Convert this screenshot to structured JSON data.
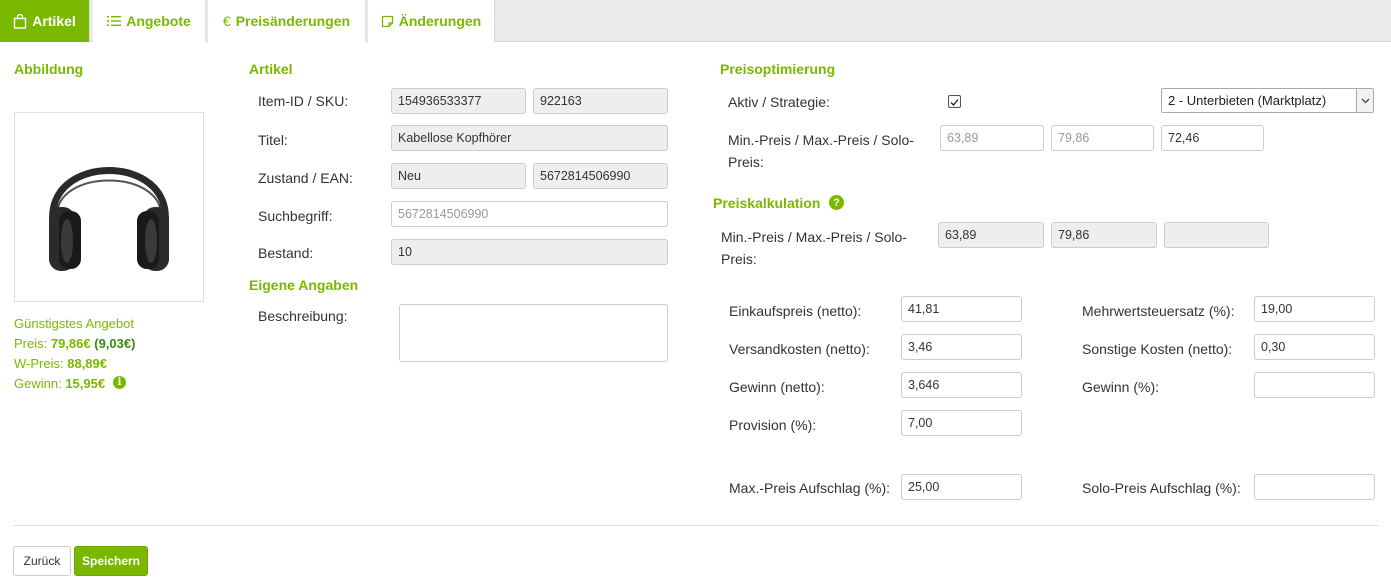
{
  "tabs": [
    {
      "label": "Artikel",
      "icon": "bag-icon",
      "active": true
    },
    {
      "label": "Angebote",
      "icon": "list-icon",
      "active": false
    },
    {
      "label": "Preisänderungen",
      "icon": "euro-icon",
      "active": false
    },
    {
      "label": "Änderungen",
      "icon": "note-icon",
      "active": false
    }
  ],
  "image_section": {
    "heading": "Abbildung",
    "best_offer_label": "Günstigstes Angebot",
    "price_label": "Preis:",
    "price_value": "79,86€",
    "price_diff": "(9,03€)",
    "w_price_label": "W-Preis:",
    "w_price_value": "88,89€",
    "profit_label": "Gewinn:",
    "profit_value": "15,95€"
  },
  "article": {
    "heading": "Artikel",
    "item_id_label": "Item-ID / SKU:",
    "item_id": "154936533377",
    "sku": "922163",
    "title_label": "Titel:",
    "title": "Kabellose Kopfhörer",
    "condition_label": "Zustand / EAN:",
    "condition": "Neu",
    "ean": "5672814506990",
    "search_label": "Suchbegriff:",
    "search_placeholder": "5672814506990",
    "stock_label": "Bestand:",
    "stock": "10"
  },
  "own": {
    "heading": "Eigene Angaben",
    "description_label": "Beschreibung:",
    "description": ""
  },
  "optimization": {
    "heading": "Preisoptimierung",
    "active_label": "Aktiv / Strategie:",
    "active_checked": true,
    "strategy": "2 - Unterbieten (Marktplatz)",
    "price_label_1": "Min.-Preis / Max.-Preis / Solo-",
    "price_label_2": "Preis:",
    "min_placeholder": "63,89",
    "max_placeholder": "79,86",
    "solo": "72,46"
  },
  "calculation": {
    "heading": "Preiskalkulation",
    "price_label_1": "Min.-Preis / Max.-Preis / Solo-",
    "price_label_2": "Preis:",
    "min": "63,89",
    "max": "79,86",
    "solo": "",
    "purchase_label": "Einkaufspreis (netto):",
    "purchase": "41,81",
    "shipping_label": "Versandkosten (netto):",
    "shipping": "3,46",
    "profit_label": "Gewinn (netto):",
    "profit": "3,646",
    "commission_label": "Provision (%):",
    "commission": "7,00",
    "max_markup_label": "Max.-Preis Aufschlag (%):",
    "max_markup": "25,00",
    "vat_label": "Mehrwertsteuersatz (%):",
    "vat": "19,00",
    "other_costs_label": "Sonstige Kosten (netto):",
    "other_costs": "0,30",
    "profit_pct_label": "Gewinn (%):",
    "profit_pct": "",
    "solo_markup_label": "Solo-Preis Aufschlag (%):",
    "solo_markup": ""
  },
  "buttons": {
    "back": "Zurück",
    "save": "Speichern"
  },
  "colors": {
    "accent": "#7ab800",
    "accent_dark": "#3b8a12"
  }
}
